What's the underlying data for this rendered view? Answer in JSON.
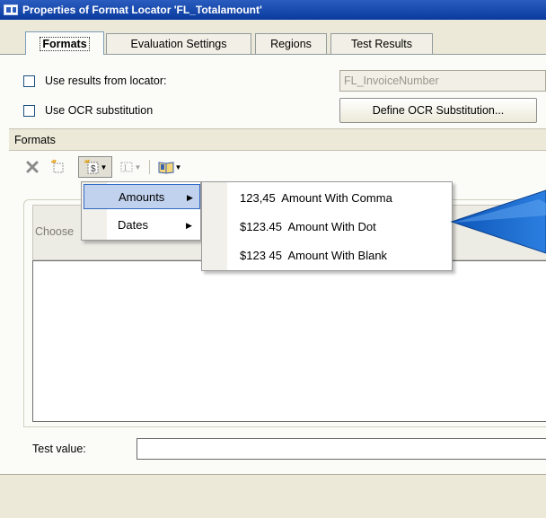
{
  "window": {
    "title": "Properties of Format Locator 'FL_Totalamount'",
    "icon": "app-window-icon"
  },
  "tabs": [
    {
      "label": "Formats",
      "active": true
    },
    {
      "label": "Evaluation Settings",
      "active": false
    },
    {
      "label": "Regions",
      "active": false
    },
    {
      "label": "Test Results",
      "active": false
    }
  ],
  "options": {
    "use_results_label": "Use results from locator:",
    "use_results_checked": false,
    "locator_value": "FL_InvoiceNumber",
    "use_ocr_label": "Use OCR substitution",
    "use_ocr_checked": false,
    "define_ocr_button": "Define OCR Substitution..."
  },
  "formats": {
    "section_label": "Formats",
    "grid_header_text": "Choose",
    "test_value_label": "Test value:",
    "test_value": ""
  },
  "toolbar": {
    "icons": [
      "delete-icon",
      "new-format-icon",
      "insert-format-icon",
      "insert-field-icon",
      "book-icon"
    ]
  },
  "menu": {
    "items": [
      {
        "label": "Amounts",
        "highlighted": true
      },
      {
        "label": "Dates",
        "highlighted": false
      }
    ],
    "submenu": [
      {
        "label": "123,45  Amount With Comma"
      },
      {
        "label": "$123.45  Amount With Dot"
      },
      {
        "label": "$123 45  Amount With Blank"
      }
    ]
  },
  "colors": {
    "title_bar": "#0a3a9e",
    "menu_highlight": "#c1d2ee",
    "callout_arrow": "#1a67c9"
  }
}
